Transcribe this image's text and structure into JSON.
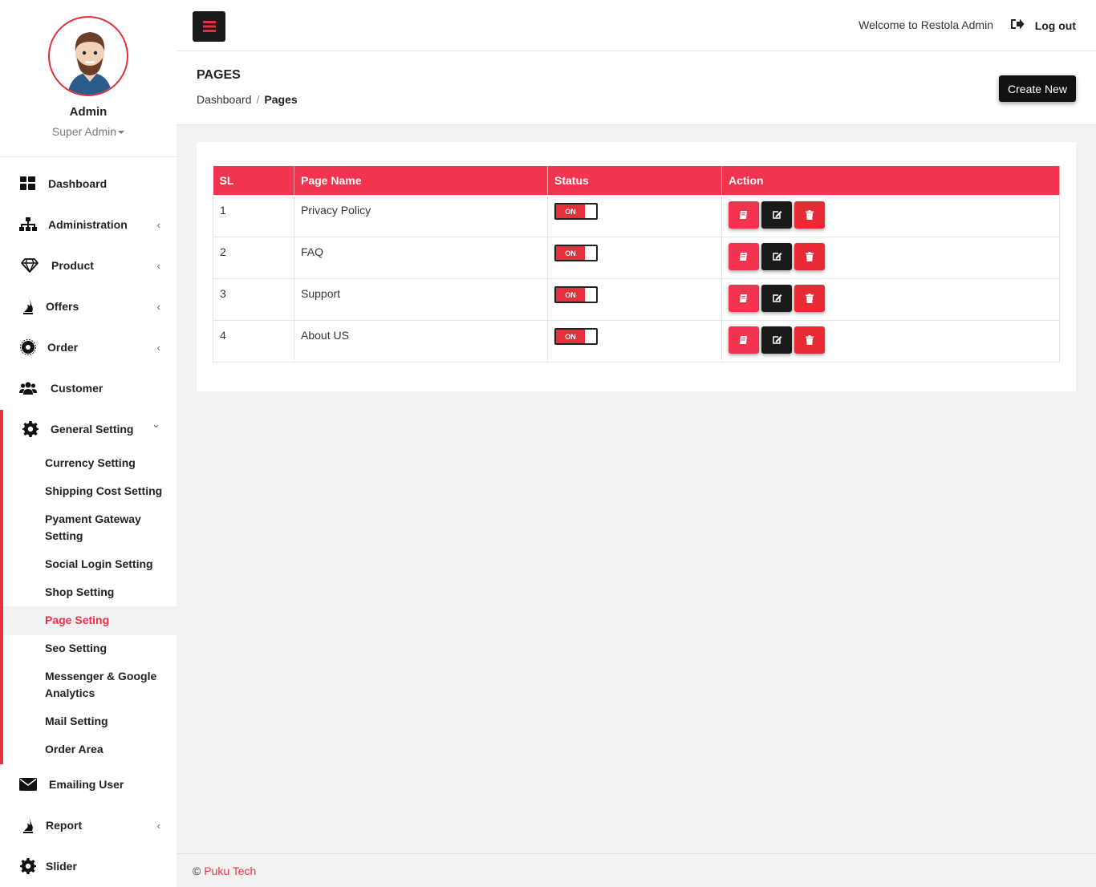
{
  "user": {
    "name": "Admin",
    "role": "Super Admin"
  },
  "header": {
    "welcome": "Welcome to Restola Admin",
    "logout": "Log out"
  },
  "page": {
    "title": "PAGES",
    "create_label": "Create New",
    "breadcrumb": {
      "home": "Dashboard",
      "sep": "/",
      "current": "Pages"
    }
  },
  "sidebar": {
    "items": [
      {
        "label": "Dashboard",
        "icon": "dashboard-icon"
      },
      {
        "label": "Administration",
        "icon": "sitemap-icon",
        "chevron": "‹"
      },
      {
        "label": "Product",
        "icon": "diamond-icon",
        "chevron": "‹"
      },
      {
        "label": "Offers",
        "icon": "fire-icon",
        "chevron": "‹"
      },
      {
        "label": "Order",
        "icon": "order-icon",
        "chevron": "‹"
      },
      {
        "label": "Customer",
        "icon": "users-icon"
      },
      {
        "label": "General Setting",
        "icon": "gear-icon",
        "chevron": "⌄"
      },
      {
        "label": "Emailing User",
        "icon": "envelope-icon"
      },
      {
        "label": "Report",
        "icon": "fire-icon",
        "chevron": "‹"
      },
      {
        "label": "Slider",
        "icon": "gear-icon"
      }
    ],
    "sub_items": [
      "Currency Setting",
      "Shipping Cost Setting",
      "Pyament Gateway Setting",
      "Social Login Setting",
      "Shop Setting",
      "Page Seting",
      "Seo Setting",
      "Messenger & Google Analytics",
      "Mail Setting",
      "Order Area"
    ]
  },
  "table": {
    "headers": {
      "sl": "SL",
      "name": "Page Name",
      "status": "Status",
      "action": "Action"
    },
    "toggle_label": "ON",
    "rows": [
      {
        "sl": "1",
        "name": "Privacy Policy"
      },
      {
        "sl": "2",
        "name": "FAQ"
      },
      {
        "sl": "3",
        "name": "Support"
      },
      {
        "sl": "4",
        "name": "About US"
      }
    ]
  },
  "footer": {
    "symbol": "©",
    "brand": "Puku Tech"
  },
  "colors": {
    "accent": "#f2344e",
    "danger": "#e82a35",
    "dark": "#1a1a1a"
  }
}
